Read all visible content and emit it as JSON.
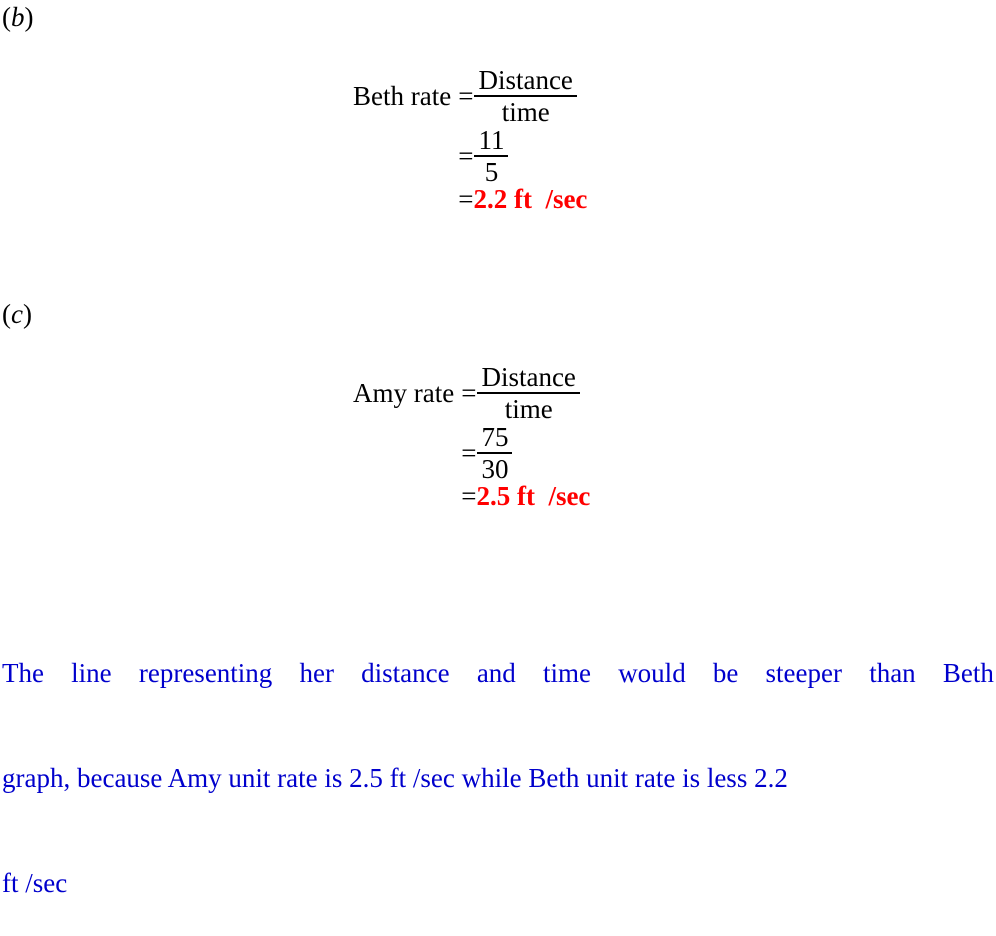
{
  "document": {
    "parts": [
      {
        "label_open": "(",
        "label_letter": "b",
        "label_close": ")",
        "equation": {
          "subject": "Beth rate",
          "relation": "=",
          "definition": {
            "numerator": "Distance",
            "denominator": "time"
          },
          "substitution": {
            "numerator": "11",
            "denominator": "5"
          },
          "result": {
            "value": "2.2",
            "unit": "ft",
            "per_unit": "/sec"
          }
        }
      },
      {
        "label_open": "(",
        "label_letter": "c",
        "label_close": ")",
        "equation": {
          "subject": "Amy rate",
          "relation": "=",
          "definition": {
            "numerator": "Distance",
            "denominator": "time"
          },
          "substitution": {
            "numerator": "75",
            "denominator": "30"
          },
          "result": {
            "value": "2.5",
            "unit": "ft",
            "per_unit": "/sec"
          }
        }
      }
    ],
    "explanation": {
      "full_text": "The line representing her distance and time would be steeper than Beth graph, because Amy unit rate is 2.5  ft /sec while Beth unit rate is less 2.2 ft /sec",
      "line1_words": [
        "The",
        "line",
        "representing",
        "her",
        "distance",
        "and",
        "time",
        "would",
        "be",
        "steeper",
        "than",
        "Beth"
      ],
      "line2": "graph, because Amy unit rate is 2.5  ft /sec while Beth unit rate is less 2.2",
      "line3": "ft /sec",
      "color": "#0000cc"
    },
    "colors": {
      "text": "#000000",
      "answer": "#ff0000",
      "explanation": "#0000cc",
      "background": "#ffffff"
    }
  }
}
